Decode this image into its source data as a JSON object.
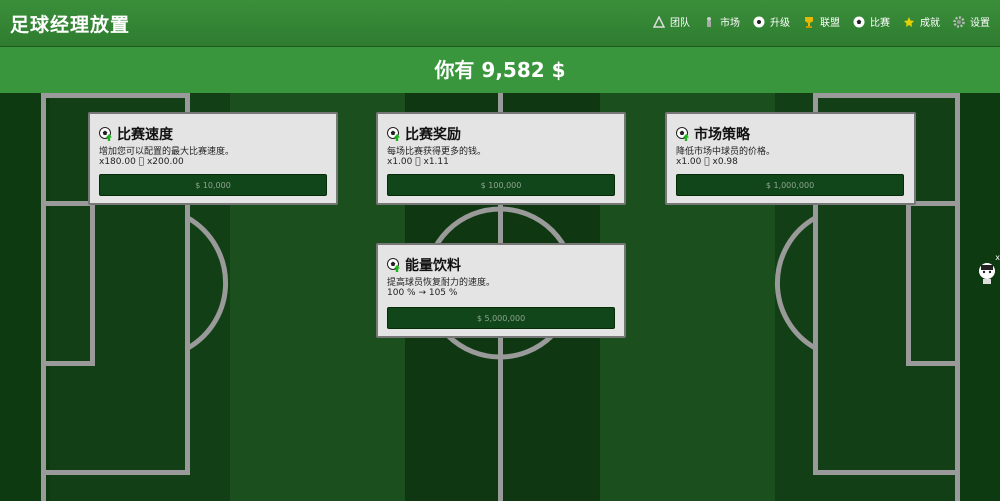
{
  "app": {
    "title": "足球经理放置"
  },
  "nav": [
    {
      "label": "团队",
      "icon": "team-icon"
    },
    {
      "label": "市场",
      "icon": "market-icon"
    },
    {
      "label": "升级",
      "icon": "upgrade-icon"
    },
    {
      "label": "联盟",
      "icon": "trophy-icon"
    },
    {
      "label": "比赛",
      "icon": "ball-icon"
    },
    {
      "label": "成就",
      "icon": "star-icon"
    },
    {
      "label": "设置",
      "icon": "gear-icon"
    }
  ],
  "money": {
    "text": "你有 9,582 $"
  },
  "upgrades": [
    {
      "title": "比赛速度",
      "desc": "增加您可以配置的最大比赛速度。",
      "values": "x180.00 ￿ x200.00",
      "price": "$ 10,000"
    },
    {
      "title": "比赛奖励",
      "desc": "每场比赛获得更多的钱。",
      "values": "x1.00 ￿ x1.11",
      "price": "$ 100,000"
    },
    {
      "title": "市场策略",
      "desc": "降低市场中球员的价格。",
      "values": "x1.00 ￿ x0.98",
      "price": "$ 1,000,000"
    },
    {
      "title": "能量饮料",
      "desc": "提高球员恢复耐力的速度。",
      "values": "100 % → 105 %",
      "price": "$ 5,000,000"
    }
  ],
  "helper": {
    "close": "x"
  },
  "colors": {
    "accent": "#3a963c",
    "button": "#11451a",
    "pitch_dark": "#0f3812",
    "pitch_light": "#1a4d1d"
  }
}
